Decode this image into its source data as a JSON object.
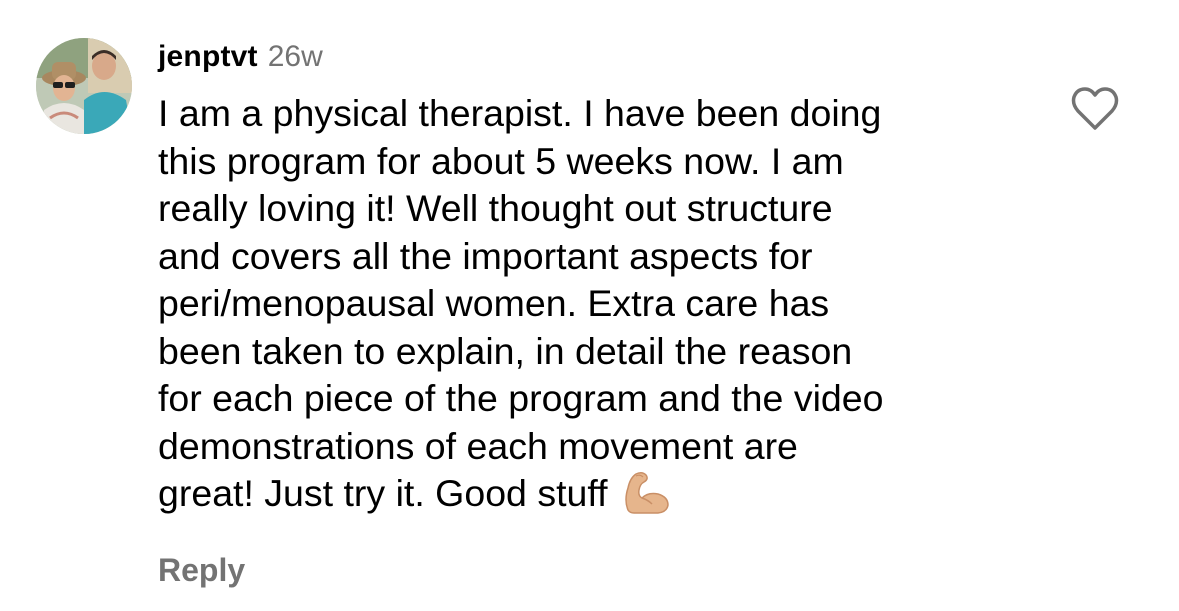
{
  "comment": {
    "username": "jenptvt",
    "time": "26w",
    "text": "I am a physical therapist.  I have been doing\nthis program for about 5 weeks now.  I am\nreally loving it!  Well thought out structure\nand covers all the important aspects for\nperi/menopausal women.  Extra care has\nbeen taken to explain, in detail the reason\nfor each piece of the program and the video\ndemonstrations of each movement are\ngreat!  Just try it.  Good stuff",
    "emoji": "flexed-biceps-emoji",
    "reply_label": "Reply",
    "like_icon": "heart-outline-icon"
  },
  "colors": {
    "text": "#000000",
    "secondary": "#737373",
    "background": "#ffffff",
    "emoji_skin": "#E6B58C"
  }
}
